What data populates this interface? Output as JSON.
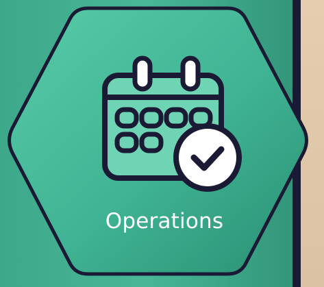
{
  "tile": {
    "label": "Operations",
    "icon": "calendar-check-icon",
    "colors": {
      "hex_fill_light": "#55c9a6",
      "hex_fill_dark": "#2e9a7c",
      "hex_border": "#1b1a35",
      "icon_fill": "#6fd4b3",
      "text": "#ffffff"
    }
  },
  "side_panel": {
    "colors": {
      "border": "#1b1a35",
      "fill": "#e6cdb0"
    }
  }
}
